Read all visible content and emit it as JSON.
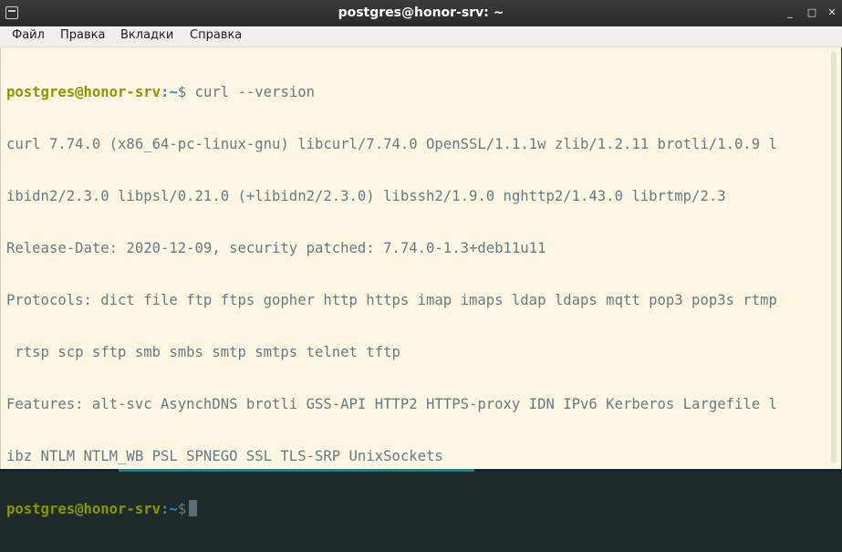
{
  "window": {
    "title": "postgres@honor-srv: ~",
    "buttons": {
      "minimize": "_",
      "maximize": "□",
      "close": "✕"
    }
  },
  "menubar": {
    "items": [
      "Файл",
      "Правка",
      "Вкладки",
      "Справка"
    ]
  },
  "terminal": {
    "prompt_user": "postgres@honor-srv",
    "prompt_path": ":~",
    "prompt_symbol": "$",
    "command": " curl --version",
    "output_lines": [
      "curl 7.74.0 (x86_64-pc-linux-gnu) libcurl/7.74.0 OpenSSL/1.1.1w zlib/1.2.11 brotli/1.0.9 l",
      "ibidn2/2.3.0 libpsl/0.21.0 (+libidn2/2.3.0) libssh2/1.9.0 nghttp2/1.43.0 librtmp/2.3",
      "Release-Date: 2020-12-09, security patched: 7.74.0-1.3+deb11u11",
      "Protocols: dict file ftp ftps gopher http https imap imaps ldap ldaps mqtt pop3 pop3s rtmp",
      " rtsp scp sftp smb smbs smtp smtps telnet tftp",
      "Features: alt-svc AsynchDNS brotli GSS-API HTTP2 HTTPS-proxy IDN IPv6 Kerberos Largefile l",
      "ibz NTLM NTLM_WB PSL SPNEGO SSL TLS-SRP UnixSockets"
    ],
    "colors": {
      "background": "#fdf6e3",
      "foreground": "#657b83",
      "user": "#859900",
      "path": "#268bd2"
    }
  }
}
